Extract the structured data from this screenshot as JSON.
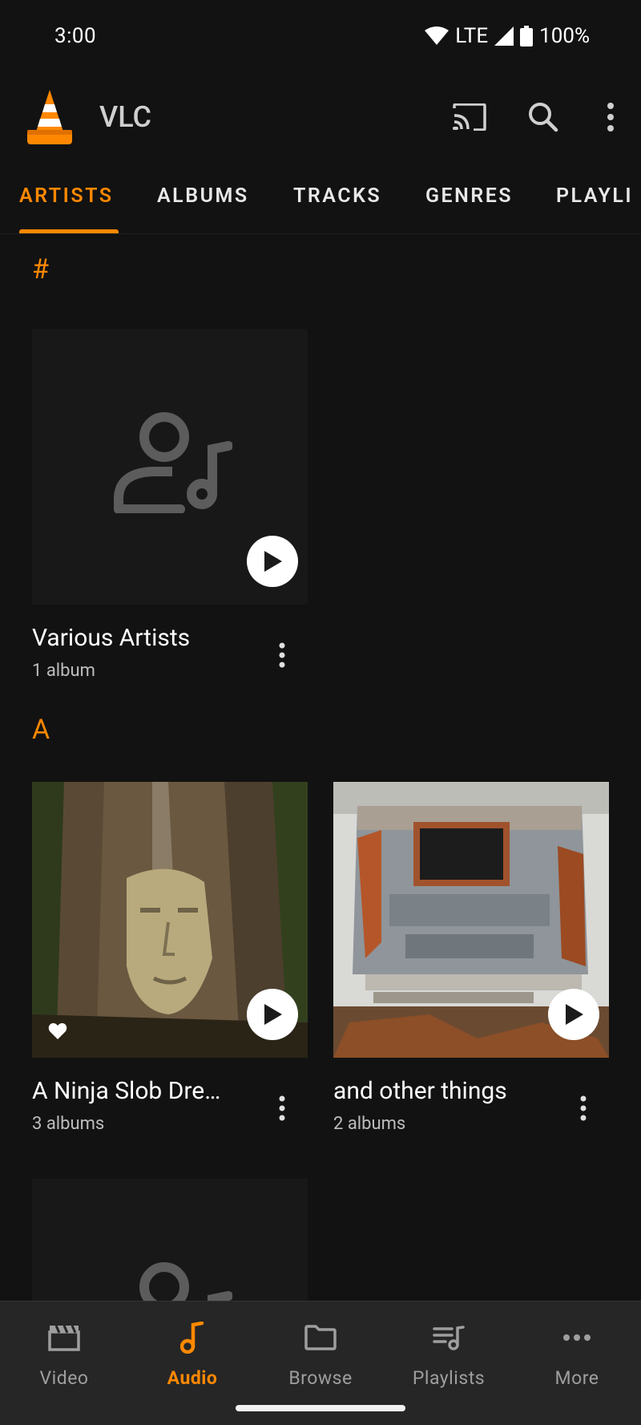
{
  "status_bar": {
    "time": "3:00",
    "network": "LTE",
    "battery": "100%"
  },
  "app_bar": {
    "title": "VLC",
    "icons": [
      "cast-icon",
      "search-icon",
      "more-vertical-icon"
    ]
  },
  "tabs": [
    {
      "label": "ARTISTS",
      "active": true
    },
    {
      "label": "ALBUMS"
    },
    {
      "label": "TRACKS"
    },
    {
      "label": "GENRES"
    },
    {
      "label": "PLAYLI"
    }
  ],
  "sections": [
    {
      "header": "#",
      "cards": [
        {
          "title": "Various Artists",
          "subtitle": "1 album",
          "art": "artist-placeholder"
        }
      ]
    },
    {
      "header": "A",
      "cards": [
        {
          "title": "A Ninja Slob Dre…",
          "subtitle": "3 albums",
          "art": "photo-face-tree",
          "favorite": true
        },
        {
          "title": "and other things",
          "subtitle": "2 albums",
          "art": "photo-rusty-bus"
        }
      ]
    }
  ],
  "bottom_nav": [
    {
      "label": "Video",
      "icon": "clapperboard-icon"
    },
    {
      "label": "Audio",
      "icon": "music-note-icon",
      "active": true
    },
    {
      "label": "Browse",
      "icon": "folder-icon"
    },
    {
      "label": "Playlists",
      "icon": "playlist-icon"
    },
    {
      "label": "More",
      "icon": "more-horizontal-icon"
    }
  ],
  "colors": {
    "accent": "#ff8800",
    "background": "#121212",
    "nav_background": "#262626"
  }
}
